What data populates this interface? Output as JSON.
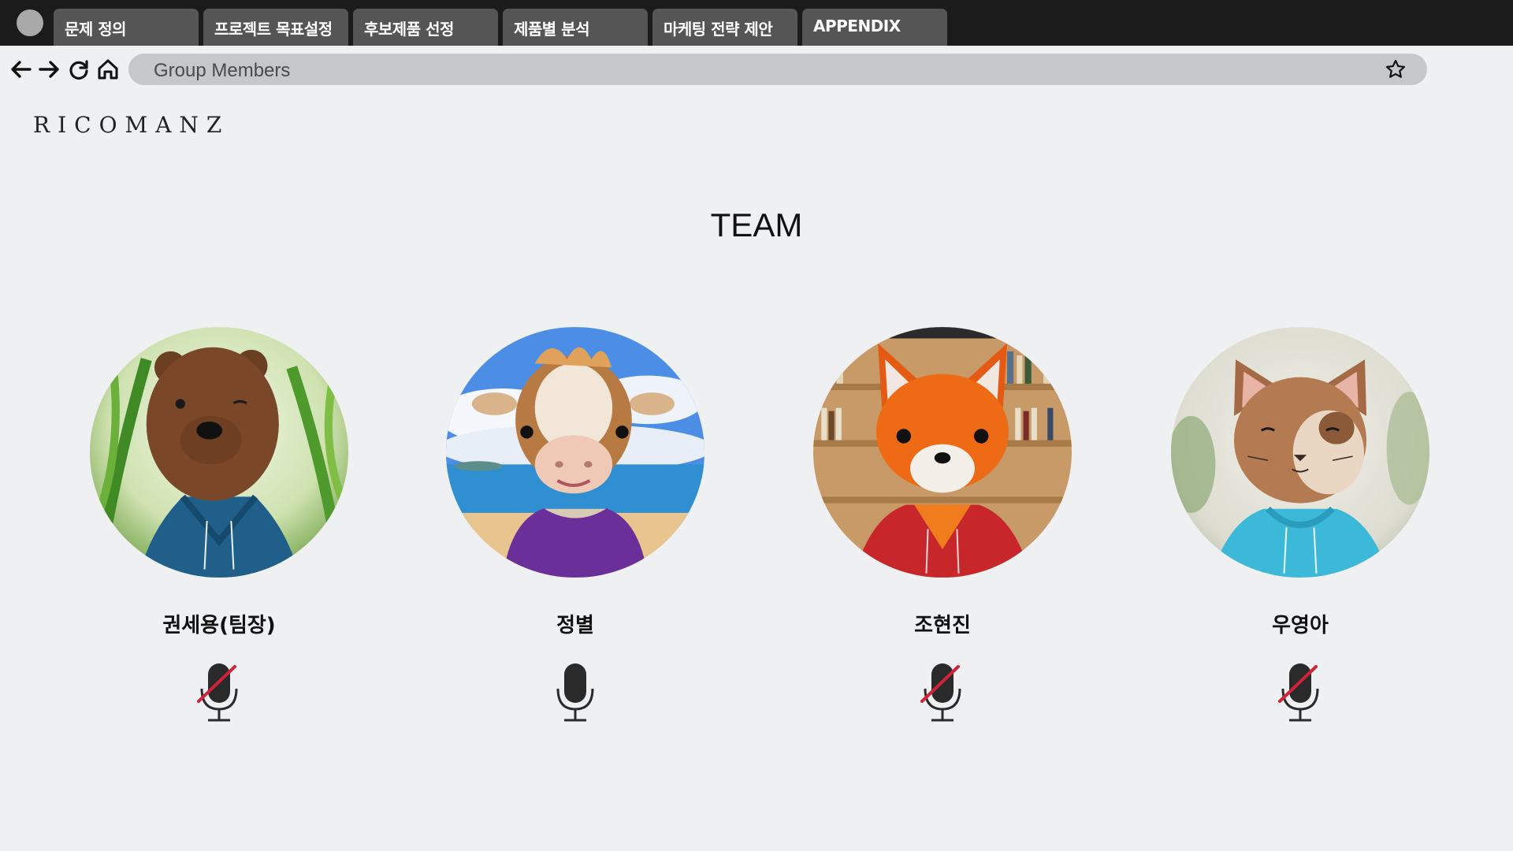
{
  "window": {
    "tabs": [
      {
        "label": "문제 정의"
      },
      {
        "label": "프로젝트 목표설정"
      },
      {
        "label": "후보제품 선정"
      },
      {
        "label": "제품별 분석"
      },
      {
        "label": "마케팅 전략 제안"
      },
      {
        "label": "APPENDIX"
      }
    ]
  },
  "navbar": {
    "address": "Group Members",
    "icons": [
      "back-arrow-icon",
      "forward-arrow-icon",
      "refresh-icon",
      "home-icon",
      "star-icon"
    ]
  },
  "brand": {
    "logo_text": "RICOMANZ"
  },
  "main": {
    "heading": "TEAM",
    "members": [
      {
        "name": "권세용(팀장)",
        "avatar": "bear-avatar",
        "muted": true
      },
      {
        "name": "정별",
        "avatar": "cow-avatar",
        "muted": false
      },
      {
        "name": "조현진",
        "avatar": "fox-avatar",
        "muted": true
      },
      {
        "name": "우영아",
        "avatar": "cat-avatar",
        "muted": true
      }
    ]
  },
  "colors": {
    "tab_strip": "#1b1b1b",
    "tab": "#555555",
    "address_bar": "#c6c7c9",
    "page_background": "#eff0f2",
    "mute_slash": "#d0233a"
  }
}
